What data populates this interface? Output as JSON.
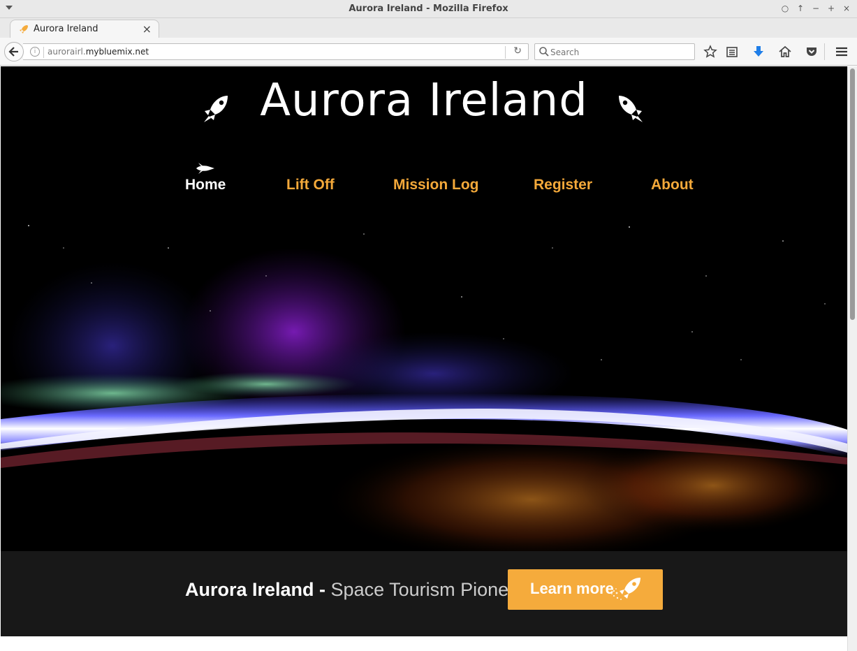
{
  "window": {
    "title": "Aurora Ireland - Mozilla Firefox"
  },
  "tab": {
    "label": "Aurora Ireland"
  },
  "urlbar": {
    "url_prefix": "aurorairl.",
    "url_domain": "mybluemix.net"
  },
  "search": {
    "placeholder": "Search"
  },
  "site": {
    "title": "Aurora Ireland",
    "nav": [
      {
        "label": "Home",
        "active": true
      },
      {
        "label": "Lift Off",
        "active": false
      },
      {
        "label": "Mission Log",
        "active": false
      },
      {
        "label": "Register",
        "active": false
      },
      {
        "label": "About",
        "active": false
      }
    ],
    "banner": {
      "brand": "Aurora Ireland",
      "separator": " - ",
      "tagline": "Space Tourism Pioneers",
      "button_label": "Learn more"
    }
  },
  "colors": {
    "accent": "#f5ab3c",
    "nav_link": "#f4a93a",
    "background": "#000000",
    "banner": "#191919"
  }
}
